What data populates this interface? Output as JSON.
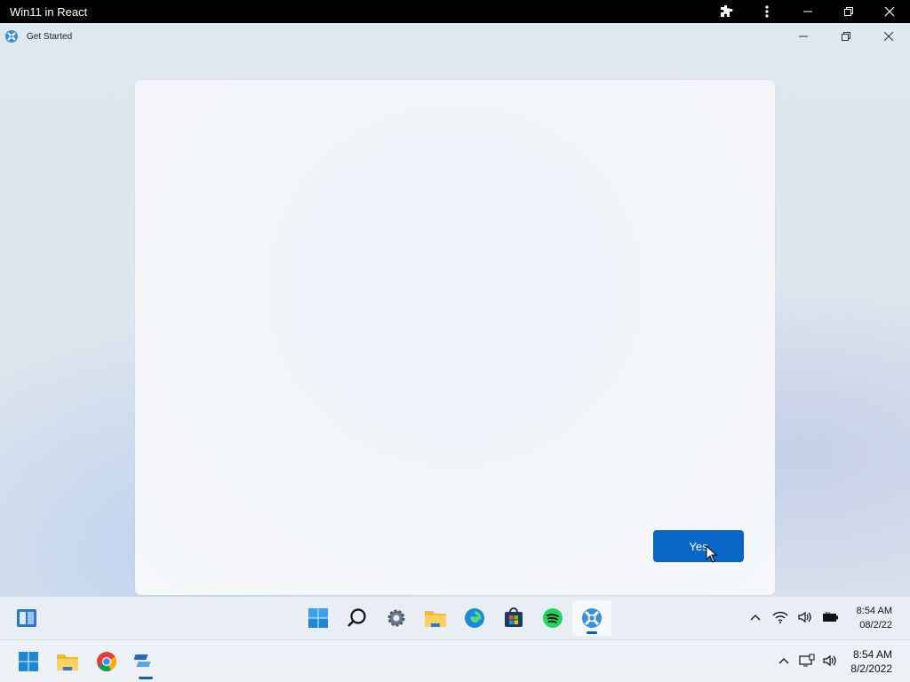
{
  "browser": {
    "title": "Win11 in React",
    "controls": {
      "extensions_icon": "puzzle-icon",
      "menu_icon": "kebab-icon",
      "minimize": "minimize-icon",
      "restore": "restore-icon",
      "close": "close-icon"
    }
  },
  "app": {
    "title": "Get Started",
    "controls": {
      "minimize": "minimize-icon",
      "restore": "restore-icon",
      "close": "close-icon"
    }
  },
  "dialog": {
    "button_label": "Yes"
  },
  "inner_taskbar": {
    "widgets_icon": "widgets-icon",
    "apps": [
      {
        "name": "start",
        "icon": "windows-logo-icon"
      },
      {
        "name": "search",
        "icon": "search-icon"
      },
      {
        "name": "settings",
        "icon": "gear-icon"
      },
      {
        "name": "file-explorer",
        "icon": "folder-icon"
      },
      {
        "name": "edge",
        "icon": "edge-icon"
      },
      {
        "name": "store",
        "icon": "store-icon"
      },
      {
        "name": "spotify",
        "icon": "spotify-icon"
      },
      {
        "name": "get-started",
        "icon": "get-started-icon",
        "active": true
      }
    ],
    "tray": [
      "chevron-up-icon",
      "wifi-icon",
      "volume-icon",
      "battery-icon"
    ],
    "time": "8:54 AM",
    "date": "08/2/22"
  },
  "os_taskbar": {
    "apps": [
      {
        "name": "start",
        "icon": "windows-logo-icon"
      },
      {
        "name": "file-explorer",
        "icon": "folder-icon"
      },
      {
        "name": "chrome",
        "icon": "chrome-icon"
      },
      {
        "name": "win11-react",
        "icon": "win11-react-icon",
        "active": true
      }
    ],
    "tray": [
      "chevron-up-icon",
      "network-icon",
      "volume-icon"
    ],
    "time": "8:54 AM",
    "date": "8/2/2022"
  },
  "colors": {
    "accent": "#0867c6",
    "titlebar": "#000000"
  }
}
